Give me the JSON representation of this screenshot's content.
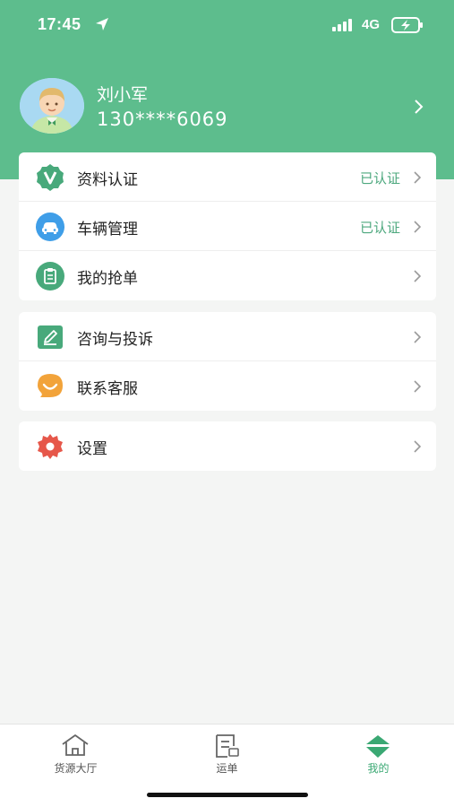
{
  "status_bar": {
    "time": "17:45",
    "network": "4G"
  },
  "profile": {
    "name": "刘小军",
    "phone": "130****6069"
  },
  "colors": {
    "brand": "#5dbd8d",
    "status_text": "#4da87e",
    "active_tab": "#3aa873"
  },
  "groups": [
    {
      "items": [
        {
          "icon": "verified-badge-icon",
          "label": "资料认证",
          "status": "已认证"
        },
        {
          "icon": "car-icon",
          "label": "车辆管理",
          "status": "已认证"
        },
        {
          "icon": "clipboard-icon",
          "label": "我的抢单",
          "status": ""
        }
      ]
    },
    {
      "items": [
        {
          "icon": "edit-note-icon",
          "label": "咨询与投诉"
        },
        {
          "icon": "smile-chat-icon",
          "label": "联系客服"
        }
      ]
    },
    {
      "items": [
        {
          "icon": "settings-gear-icon",
          "label": "设置"
        }
      ]
    }
  ],
  "tabs": [
    {
      "icon": "home-icon",
      "label": "货源大厅",
      "active": false
    },
    {
      "icon": "waybill-icon",
      "label": "运单",
      "active": false
    },
    {
      "icon": "profile-tab-icon",
      "label": "我的",
      "active": true
    }
  ]
}
